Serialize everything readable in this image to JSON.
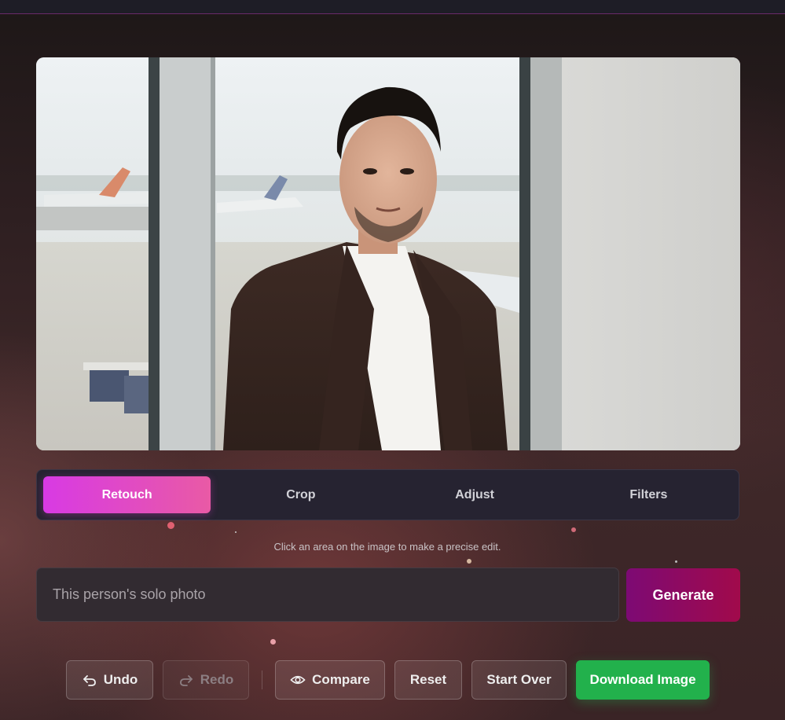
{
  "tabs": [
    {
      "label": "Retouch",
      "active": true
    },
    {
      "label": "Crop",
      "active": false
    },
    {
      "label": "Adjust",
      "active": false
    },
    {
      "label": "Filters",
      "active": false
    }
  ],
  "hint": "Click an area on the image to make a precise edit.",
  "prompt": {
    "placeholder": "This person's solo photo",
    "value": ""
  },
  "generate_label": "Generate",
  "actions": {
    "undo": "Undo",
    "redo": "Redo",
    "compare": "Compare",
    "reset": "Reset",
    "start_over": "Start Over",
    "download": "Download Image"
  },
  "colors": {
    "accent_gradient": [
      "#d83ae4",
      "#e95aa5"
    ],
    "generate_gradient": [
      "#7d0a74",
      "#a10a4b"
    ],
    "download": "#22b14c"
  }
}
